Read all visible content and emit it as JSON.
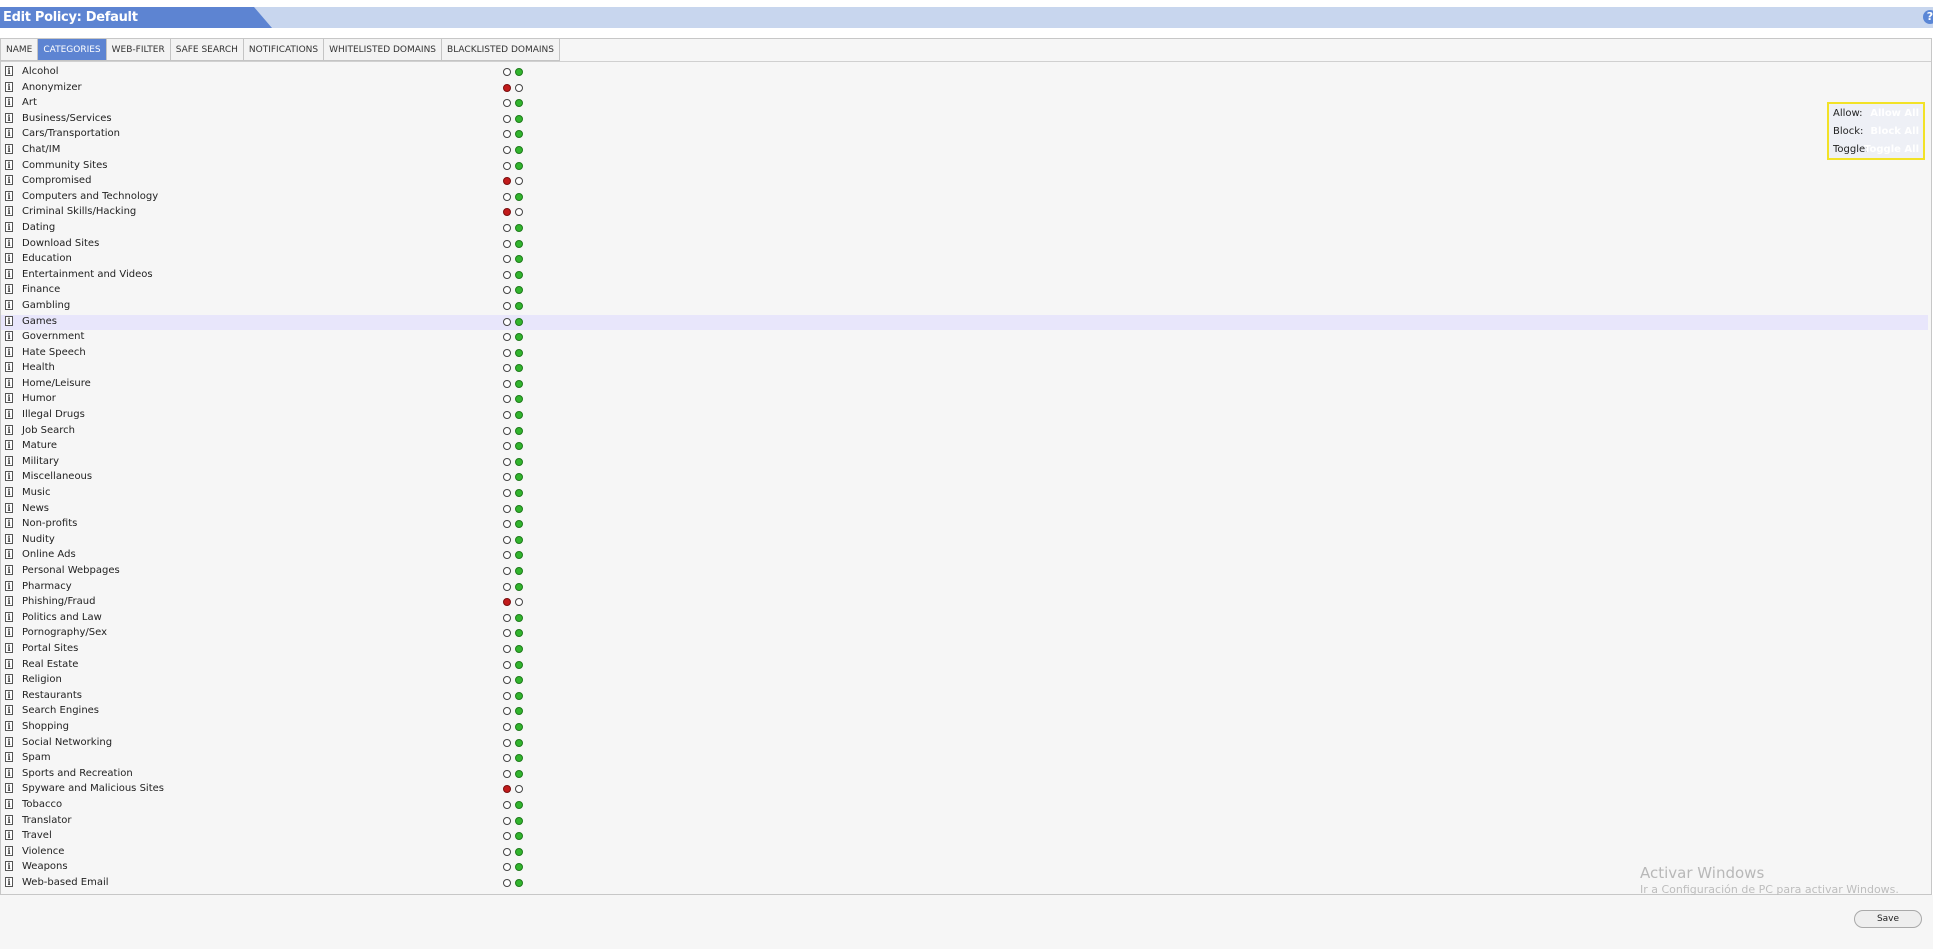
{
  "window": {
    "title": "Edit Policy: Default",
    "help_glyph": "?"
  },
  "tabs": [
    "NAME",
    "CATEGORIES",
    "WEB-FILTER",
    "SAFE SEARCH",
    "NOTIFICATIONS",
    "WHITELISTED DOMAINS",
    "BLACKLISTED DOMAINS"
  ],
  "active_tab": "CATEGORIES",
  "info_glyph": "i",
  "categories": [
    {
      "label": "Alcohol",
      "status": "allow"
    },
    {
      "label": "Anonymizer",
      "status": "block"
    },
    {
      "label": "Art",
      "status": "allow"
    },
    {
      "label": "Business/Services",
      "status": "allow"
    },
    {
      "label": "Cars/Transportation",
      "status": "allow"
    },
    {
      "label": "Chat/IM",
      "status": "allow"
    },
    {
      "label": "Community Sites",
      "status": "allow"
    },
    {
      "label": "Compromised",
      "status": "block"
    },
    {
      "label": "Computers and Technology",
      "status": "allow"
    },
    {
      "label": "Criminal Skills/Hacking",
      "status": "block"
    },
    {
      "label": "Dating",
      "status": "allow"
    },
    {
      "label": "Download Sites",
      "status": "allow"
    },
    {
      "label": "Education",
      "status": "allow"
    },
    {
      "label": "Entertainment and Videos",
      "status": "allow"
    },
    {
      "label": "Finance",
      "status": "allow"
    },
    {
      "label": "Gambling",
      "status": "allow"
    },
    {
      "label": "Games",
      "status": "allow",
      "highlight": true
    },
    {
      "label": "Government",
      "status": "allow"
    },
    {
      "label": "Hate Speech",
      "status": "allow"
    },
    {
      "label": "Health",
      "status": "allow"
    },
    {
      "label": "Home/Leisure",
      "status": "allow"
    },
    {
      "label": "Humor",
      "status": "allow"
    },
    {
      "label": "Illegal Drugs",
      "status": "allow"
    },
    {
      "label": "Job Search",
      "status": "allow"
    },
    {
      "label": "Mature",
      "status": "allow"
    },
    {
      "label": "Military",
      "status": "allow"
    },
    {
      "label": "Miscellaneous",
      "status": "allow"
    },
    {
      "label": "Music",
      "status": "allow"
    },
    {
      "label": "News",
      "status": "allow"
    },
    {
      "label": "Non-profits",
      "status": "allow"
    },
    {
      "label": "Nudity",
      "status": "allow"
    },
    {
      "label": "Online Ads",
      "status": "allow"
    },
    {
      "label": "Personal Webpages",
      "status": "allow"
    },
    {
      "label": "Pharmacy",
      "status": "allow"
    },
    {
      "label": "Phishing/Fraud",
      "status": "block"
    },
    {
      "label": "Politics and Law",
      "status": "allow"
    },
    {
      "label": "Pornography/Sex",
      "status": "allow"
    },
    {
      "label": "Portal Sites",
      "status": "allow"
    },
    {
      "label": "Real Estate",
      "status": "allow"
    },
    {
      "label": "Religion",
      "status": "allow"
    },
    {
      "label": "Restaurants",
      "status": "allow"
    },
    {
      "label": "Search Engines",
      "status": "allow"
    },
    {
      "label": "Shopping",
      "status": "allow"
    },
    {
      "label": "Social Networking",
      "status": "allow"
    },
    {
      "label": "Spam",
      "status": "allow"
    },
    {
      "label": "Sports and Recreation",
      "status": "allow"
    },
    {
      "label": "Spyware and Malicious Sites",
      "status": "block"
    },
    {
      "label": "Tobacco",
      "status": "allow"
    },
    {
      "label": "Translator",
      "status": "allow"
    },
    {
      "label": "Travel",
      "status": "allow"
    },
    {
      "label": "Violence",
      "status": "allow"
    },
    {
      "label": "Weapons",
      "status": "allow"
    },
    {
      "label": "Web-based Email",
      "status": "allow"
    }
  ],
  "bulk_actions": [
    {
      "label": "Allow:",
      "button": "Allow All"
    },
    {
      "label": "Block:",
      "button": "Block All"
    },
    {
      "label": "Toggle:",
      "button": "Toggle All"
    }
  ],
  "watermark": {
    "title": "Activar Windows",
    "subtitle": "Ir a Configuración de PC para activar Windows."
  },
  "footer": {
    "save_label": "Save"
  },
  "colors": {
    "accent": "#5d84d2",
    "block_on": "#c21b1b",
    "allow_on": "#32b52e",
    "row_highlight": "#e8e6fb",
    "bulk_border": "#f2e227"
  }
}
